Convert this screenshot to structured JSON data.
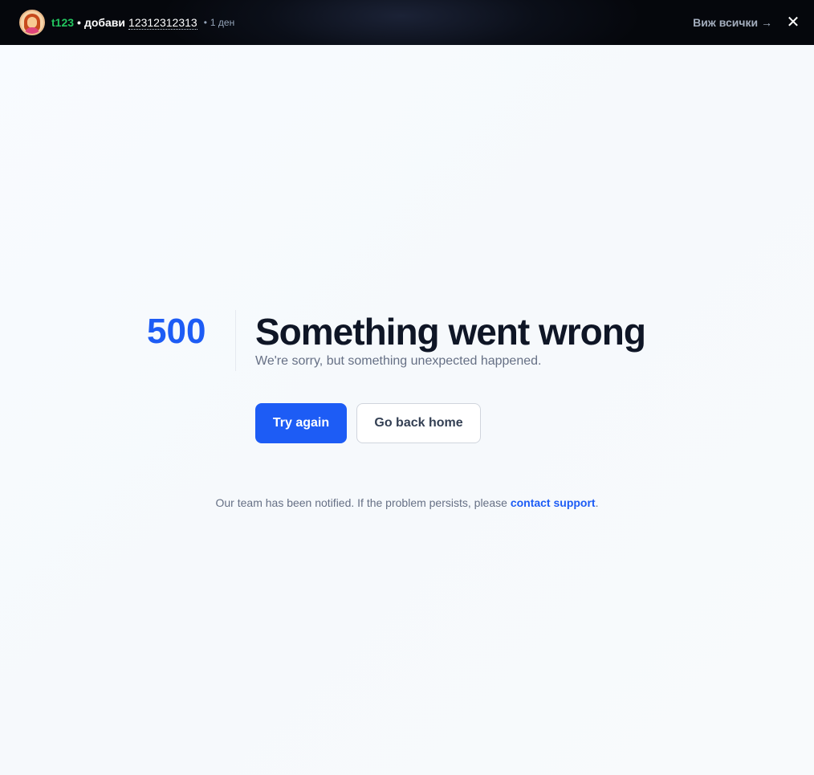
{
  "notification": {
    "user": "t123",
    "separator": "•",
    "action": "добави",
    "item": "12312312313",
    "dot": "•",
    "time": "1 ден",
    "view_all": "Виж всички →",
    "close_icon": "✕"
  },
  "error": {
    "code": "500",
    "title": "Something went wrong",
    "subtitle": "We're sorry, but something unexpected happened.",
    "primary_button": "Try again",
    "secondary_button": "Go back home",
    "footer_text": "Our team has been notified. If the problem persists, please ",
    "footer_link": "contact support",
    "footer_end": "."
  },
  "colors": {
    "accent": "#1d5cf5",
    "username": "#22c55e",
    "title": "#0f1626",
    "muted": "#667085"
  }
}
